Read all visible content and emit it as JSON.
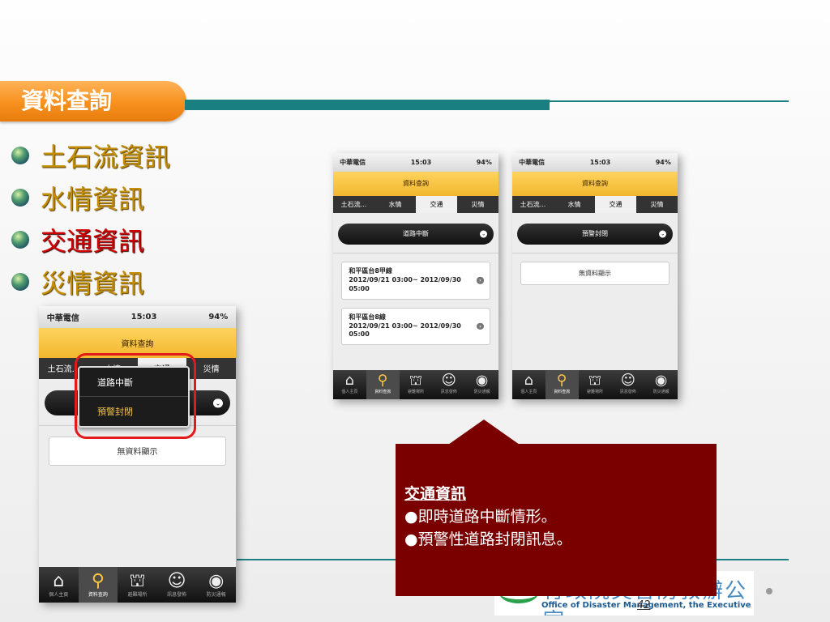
{
  "slide": {
    "title": "資料查詢",
    "bullets": [
      {
        "text": "土石流資訊",
        "highlight": false
      },
      {
        "text": "水情資訊",
        "highlight": false
      },
      {
        "text": "交通資訊",
        "highlight": true
      },
      {
        "text": "災情資訊",
        "highlight": false
      }
    ],
    "page_number": "42"
  },
  "colors": {
    "accent_teal": "#1a7f80",
    "title_orange": "#f7901e",
    "bullet_gold": "#c48e00",
    "highlight_red": "#d00000",
    "callout_bg": "#7a0000"
  },
  "phone_ui": {
    "carrier": "中華電信",
    "time": "15:03",
    "battery": "94%",
    "nav_title": "資料查詢",
    "tabs": [
      "土石流...",
      "水情",
      "交通",
      "災情"
    ],
    "selected_tab": "交通",
    "tabbar": [
      "個人主頁",
      "資料查詢",
      "避難場所",
      "訊息發佈",
      "防災通報"
    ],
    "tabbar_icons": [
      "home-icon",
      "search-icon",
      "shelter-icon",
      "message-icon",
      "report-icon"
    ]
  },
  "screen_road": {
    "dropdown": "道路中斷",
    "items": [
      {
        "road": "和平區台8甲線",
        "period": "2012/09/21 03:00~ 2012/09/30 05:00"
      },
      {
        "road": "和平區台8線",
        "period": "2012/09/21 03:00~ 2012/09/30 05:00"
      }
    ]
  },
  "screen_closure": {
    "dropdown": "預警封閉",
    "no_data": "無資料顯示"
  },
  "screen_picker": {
    "options": [
      "道路中斷",
      "預警封閉"
    ],
    "no_data": "無資料顯示"
  },
  "callout": {
    "heading": "交通資訊",
    "lines": [
      "●即時道路中斷情形。",
      "●預警性道路封閉訊息。"
    ]
  },
  "logo": {
    "chinese": "行政院災害防救辦公室",
    "english": "Office of Disaster Management, the Executive Yuan"
  }
}
